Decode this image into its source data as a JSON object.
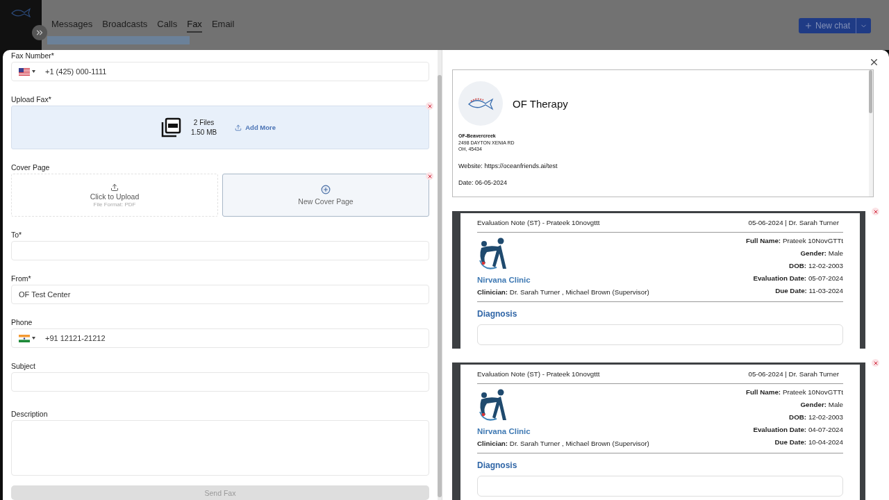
{
  "app": {
    "tabs": [
      {
        "label": "Messages",
        "selected": false
      },
      {
        "label": "Broadcasts",
        "selected": false
      },
      {
        "label": "Calls",
        "selected": false
      },
      {
        "label": "Fax",
        "selected": true
      },
      {
        "label": "Email",
        "selected": false
      }
    ],
    "new_chat": "New chat"
  },
  "form": {
    "fields": [
      {
        "kind": "phone",
        "label": "Fax Number*",
        "flag": {
          "kind": "us"
        },
        "value": "+1 (425) 000-1111"
      },
      {
        "kind": "upload",
        "label": "Upload Fax*",
        "files": "2 Files",
        "size": "1.50 MB",
        "action": "Add More"
      },
      {
        "kind": "cover",
        "label": "Cover Page",
        "upload": "Click to Upload",
        "hint": "File Format: PDF",
        "create": "New Cover Page"
      },
      {
        "kind": "text",
        "label": "To*"
      },
      {
        "kind": "text",
        "label": "From*",
        "value": "OF Test Center"
      },
      {
        "kind": "phone",
        "label": "Phone",
        "flag": {
          "kind": "in"
        },
        "value": "+91 12121-21212"
      },
      {
        "kind": "text",
        "label": "Subject"
      },
      {
        "kind": "textarea",
        "label": "Description"
      }
    ],
    "submit": {
      "label": "Send Fax",
      "disabled": true
    }
  },
  "preview": {
    "cover": {
      "company": "OF Therapy",
      "branch": "OF-Beavercreek",
      "address": [
        "2498 DAYTON XENIA RD",
        "OH, 45434"
      ],
      "website_label": "Website:",
      "website": "https://oceanfriends.ai/test",
      "date": "Date: 06-05-2024"
    },
    "notes": [
      {
        "title": "Evaluation Note (ST) - Prateek 10novgttt",
        "meta": "05-06-2024 | Dr. Sarah Turner",
        "clinic": "Nirvana Clinic",
        "clinician_label": "Clinician:",
        "clinician": "Dr. Sarah Turner , Michael Brown (Supervisor)",
        "fields": [
          {
            "label": "Full Name:",
            "value": "Prateek 10NovGTTt"
          },
          {
            "label": "Gender:",
            "value": "Male"
          },
          {
            "label": "DOB:",
            "value": "12-02-2003"
          },
          {
            "label": "Evaluation Date:",
            "value": "05-07-2024"
          },
          {
            "label": "Due Date:",
            "value": "11-03-2024"
          }
        ],
        "section": "Diagnosis"
      },
      {
        "title": "Evaluation Note (ST) - Prateek 10novgttt",
        "meta": "05-06-2024 | Dr. Sarah Turner",
        "clinic": "Nirvana Clinic",
        "clinician_label": "Clinician:",
        "clinician": "Dr. Sarah Turner , Michael Brown (Supervisor)",
        "fields": [
          {
            "label": "Full Name:",
            "value": "Prateek 10NovGTTt"
          },
          {
            "label": "Gender:",
            "value": "Male"
          },
          {
            "label": "DOB:",
            "value": "12-02-2003"
          },
          {
            "label": "Evaluation Date:",
            "value": "04-07-2024"
          },
          {
            "label": "Due Date:",
            "value": "10-04-2024"
          }
        ],
        "section": "Diagnosis"
      }
    ]
  }
}
